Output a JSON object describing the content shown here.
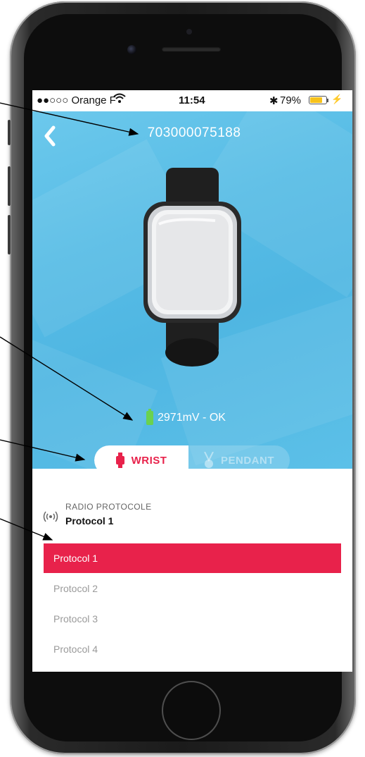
{
  "status_bar": {
    "carrier": "●●○○○ Orange F",
    "time": "11:54",
    "battery_percent": "79%",
    "bluetooth_icon": "bluetooth-icon",
    "wifi_icon": "wifi-icon",
    "charging_icon": "charging-bolt-icon",
    "battery_level": 0.79
  },
  "header": {
    "device_id": "703000075188",
    "back_icon": "chevron-left-icon"
  },
  "device": {
    "image": "wristband-device-image",
    "battery_status": "2971mV - OK",
    "battery_icon": "battery-icon"
  },
  "mode_toggle": {
    "wrist_label": "WRIST",
    "pendant_label": "PENDANT",
    "selected": "WRIST"
  },
  "radio_section": {
    "label": "RADIO PROTOCOLE",
    "value": "Protocol 1",
    "icon": "radio-signal-icon"
  },
  "protocol_options": [
    "Protocol 1",
    "Protocol 2",
    "Protocol 3",
    "Protocol 4"
  ],
  "selected_protocol": "Protocol 1",
  "colors": {
    "accent_red": "#e8224b",
    "hero_blue": "#58bde6",
    "battery_green": "#6ad24f"
  }
}
